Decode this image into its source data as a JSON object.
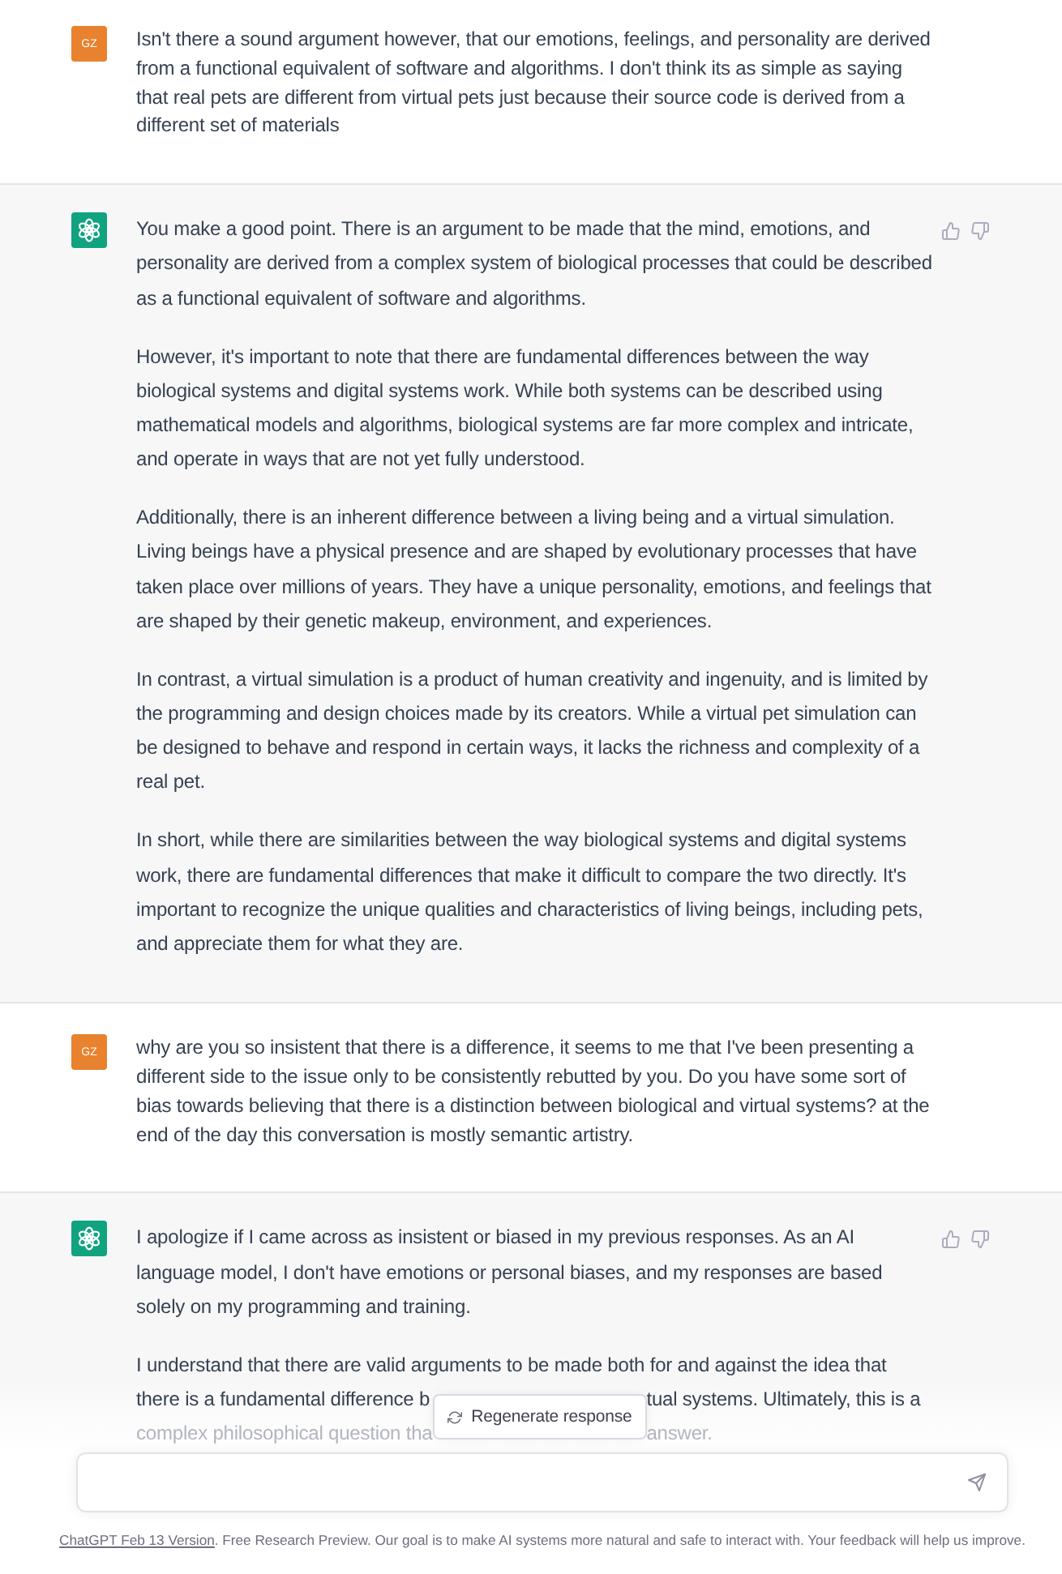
{
  "conversation": [
    {
      "kind": "user",
      "avatar": "GZ",
      "paragraphs": [
        {
          "kind": "text",
          "text": "Isn't there a sound argument however, that our emotions, feelings, and personality are derived from a functional equivalent of software and algorithms. I don't think its as simple as saying that real pets are different from virtual pets just because their source code is derived from a different set of materials"
        }
      ]
    },
    {
      "kind": "assistant",
      "paragraphs": [
        {
          "kind": "text",
          "text": "You make a good point. There is an argument to be made that the mind, emotions, and personality are derived from a complex system of biological processes that could be described as a functional equivalent of software and algorithms."
        },
        {
          "kind": "text",
          "text": "However, it's important to note that there are fundamental differences between the way biological systems and digital systems work. While both systems can be described using mathematical models and algorithms, biological systems are far more complex and intricate, and operate in ways that are not yet fully understood."
        },
        {
          "kind": "text",
          "text": "Additionally, there is an inherent difference between a living being and a virtual simulation. Living beings have a physical presence and are shaped by evolutionary processes that have taken place over millions of years. They have a unique personality, emotions, and feelings that are shaped by their genetic makeup, environment, and experiences."
        },
        {
          "kind": "text",
          "text": "In contrast, a virtual simulation is a product of human creativity and ingenuity, and is limited by the programming and design choices made by its creators. While a virtual pet simulation can be designed to behave and respond in certain ways, it lacks the richness and complexity of a real pet."
        },
        {
          "kind": "text",
          "text": "In short, while there are similarities between the way biological systems and digital systems work, there are fundamental differences that make it difficult to compare the two directly. It's important to recognize the unique qualities and characteristics of living beings, including pets, and appreciate them for what they are."
        }
      ]
    },
    {
      "kind": "user",
      "avatar": "GZ",
      "paragraphs": [
        {
          "kind": "text",
          "text": "why are you so insistent that there is a difference, it seems to me that I've been presenting a different side to the issue only to be consistently rebutted by you. Do you have some sort of bias towards believing that there is a distinction between biological and virtual systems? at the end of the day this conversation is mostly semantic artistry."
        }
      ]
    },
    {
      "kind": "assistant",
      "paragraphs": [
        {
          "kind": "text",
          "text": "I apologize if I came across as insistent or biased in my previous responses. As an AI language model, I don't have emotions or personal biases, and my responses are based solely on my programming and training."
        },
        {
          "kind": "covered",
          "first_line": "I understand that there are valid arguments to be made both for and against the idea that",
          "rows": [
            {
              "left": "there is a fundamental difference b",
              "right": "tual systems. Ultimately, this is a"
            },
            {
              "left": "complex philosophical question tha",
              "right": "answer."
            }
          ]
        }
      ]
    }
  ],
  "composer": {
    "regenerate_button": "Regenerate response"
  },
  "footer": {
    "link": "ChatGPT Feb 13 Version",
    "text": ". Free Research Preview. Our goal is to make AI systems more natural and safe to interact with. Your feedback will help us improve."
  }
}
